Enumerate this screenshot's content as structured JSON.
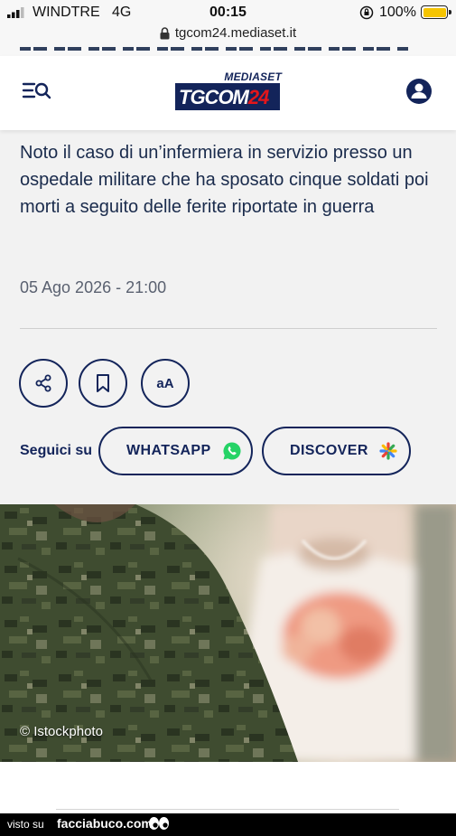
{
  "status_bar": {
    "carrier": "WINDTRE",
    "network": "4G",
    "time": "00:15",
    "battery": "100%"
  },
  "browser": {
    "url": "tgcom24.mediaset.it"
  },
  "header": {
    "logo_top": "MEDIASET",
    "logo_main": "TGCOM",
    "logo_num": "24"
  },
  "article": {
    "headline": "Noto il caso di un’infermiera in servizio presso un ospedale militare che ha sposato cinque soldati poi morti a seguito delle ferite riportate in guerra",
    "date": "05 Ago 2026 - 21:00",
    "font_button": "aA",
    "follow_label": "Seguici su",
    "whatsapp_label": "WHATSAPP",
    "discover_label": "DISCOVER",
    "photo_credit": "© Istockphoto"
  },
  "watermark": {
    "prefix": "visto su",
    "site": "facciabuco.com"
  },
  "colors": {
    "navy": "#13245a",
    "red": "#e3161b",
    "whatsapp_green": "#25d366",
    "background": "#f2f2f2"
  },
  "icons": [
    "signal-icon",
    "lock-icon",
    "menu-search-icon",
    "user-icon",
    "share-icon",
    "bookmark-icon",
    "whatsapp-icon",
    "discover-icon"
  ]
}
